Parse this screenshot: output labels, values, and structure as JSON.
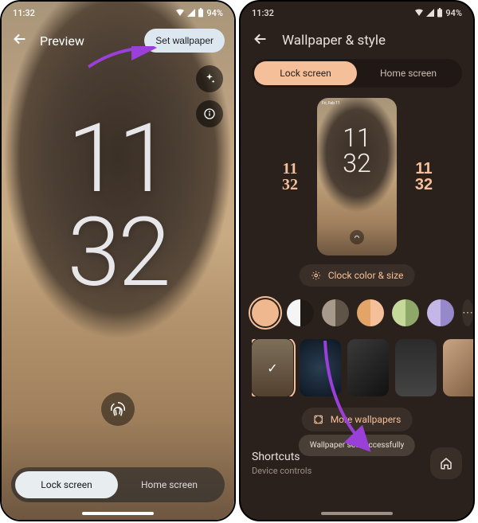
{
  "status": {
    "time": "11:32",
    "battery_pct": "94%"
  },
  "left": {
    "title": "Preview",
    "set_wallpaper": "Set wallpaper",
    "clock_top": "11",
    "clock_bottom": "32",
    "tabs": {
      "lock": "Lock screen",
      "home": "Home screen"
    }
  },
  "right": {
    "title": "Wallpaper & style",
    "tabs": {
      "lock": "Lock screen",
      "home": "Home screen"
    },
    "mini": {
      "status": "Fri, Feb 11",
      "clock_top": "11",
      "clock_bottom": "32"
    },
    "style_left": {
      "top": "11",
      "bottom": "32"
    },
    "style_right": {
      "top": "11",
      "bottom": "32"
    },
    "clock_size": "Clock color & size",
    "colors": [
      "#f0b88f",
      "#f5f5f5",
      "#a89a8a",
      "#e3a468",
      "#c6d99a",
      "#c4b7e8"
    ],
    "more_wallpapers": "More wallpapers",
    "toast": "Wallpaper set successfully",
    "shortcuts": {
      "title": "Shortcuts",
      "sub": "Device controls"
    }
  }
}
